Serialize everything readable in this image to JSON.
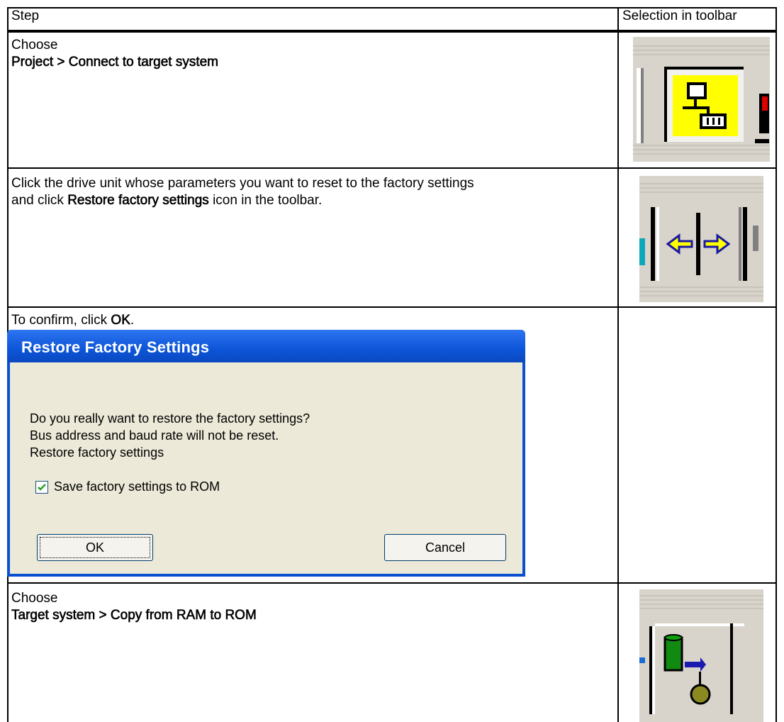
{
  "table": {
    "headers": [
      "Step",
      "Selection in toolbar"
    ],
    "rows": [
      {
        "line1": "Choose",
        "line2": "Project > Connect to target system"
      },
      {
        "line1_pre": "Click the drive unit whose parameters you want to reset to the factory settings",
        "line2_pre": "and click ",
        "line2_bold": "Restore factory settings",
        "line2_post": " icon in the toolbar."
      },
      {
        "line1_pre": "To confirm, click ",
        "line1_bold": "OK",
        "line1_post": "."
      },
      {
        "line1": "Choose",
        "line2": "Target system > Copy from RAM to ROM"
      }
    ]
  },
  "dialog": {
    "title": "Restore Factory Settings",
    "lines": [
      "Do you really want to restore the factory settings?",
      "Bus address and baud rate will not be reset.",
      "Restore factory settings"
    ],
    "checkbox_label": "Save factory settings to ROM",
    "checkbox_checked": true,
    "ok_label": "OK",
    "cancel_label": "Cancel"
  },
  "icons": {
    "row1": "network-connect-icon",
    "row2": "restore-factory-settings-icon",
    "row4": "copy-ram-to-rom-icon"
  },
  "colors": {
    "dialog_title": "#0d55d8",
    "dialog_body": "#ece9d8",
    "highlight_yellow": "#ffff00"
  }
}
